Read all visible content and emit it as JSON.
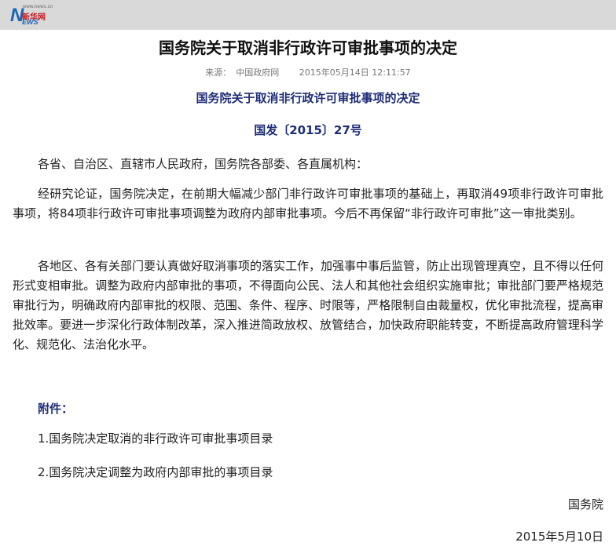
{
  "header": {
    "logo_url_text": "www.news.cn",
    "logo_letter": "N",
    "logo_chinese": "新华网",
    "logo_suffix": "EWS"
  },
  "article": {
    "title": "国务院关于取消非行政许可审批事项的决定",
    "source_label": "来源：",
    "source": "中国政府网",
    "datetime": "2015年05月14日 12:11:57"
  },
  "document": {
    "title": "国务院关于取消非行政许可审批事项的决定",
    "number": "国发〔2015〕27号",
    "addressees": "各省、自治区、直辖市人民政府，国务院各部委、各直属机构：",
    "paragraphs": [
      "经研究论证，国务院决定，在前期大幅减少部门非行政许可审批事项的基础上，再取消49项非行政许可审批事项，将84项非行政许可审批事项调整为政府内部审批事项。今后不再保留“非行政许可审批”这一审批类别。",
      "各地区、各有关部门要认真做好取消事项的落实工作，加强事中事后监管，防止出现管理真空，且不得以任何形式变相审批。调整为政府内部审批的事项，不得面向公民、法人和其他社会组织实施审批；审批部门要严格规范审批行为，明确政府内部审批的权限、范围、条件、程序、时限等，严格限制自由裁量权，优化审批流程，提高审批效率。要进一步深化行政体制改革，深入推进简政放权、放管结合，加快政府职能转变，不断提高政府管理科学化、规范化、法治化水平。"
    ],
    "attachments_label": "附件：",
    "attachments": [
      "1.国务院决定取消的非行政许可审批事项目录",
      "2.国务院决定调整为政府内部审批的事项目录"
    ],
    "signer": "国务院",
    "sign_date": "2015年5月10日"
  }
}
